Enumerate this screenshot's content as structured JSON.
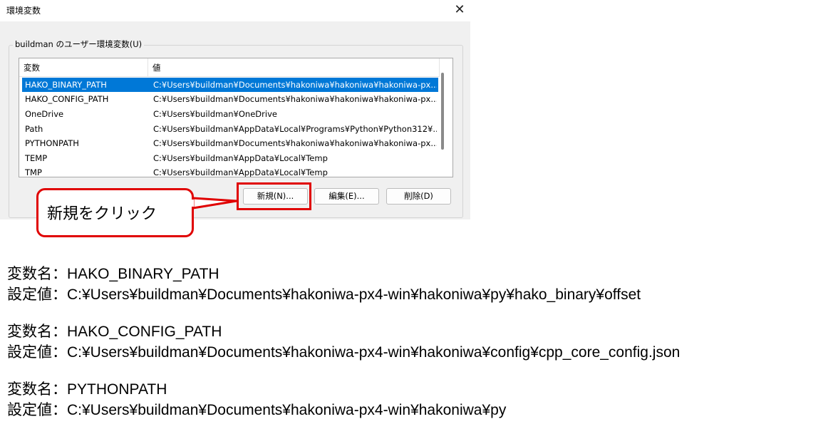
{
  "dialog": {
    "title": "環境変数",
    "close_icon": "close-icon",
    "group_label": "buildman のユーザー環境変数(U)",
    "columns": {
      "name": "変数",
      "value": "値"
    },
    "rows": [
      {
        "name": "HAKO_BINARY_PATH",
        "value": "C:¥Users¥buildman¥Documents¥hakoniwa¥hakoniwa¥hakoniwa-px...",
        "selected": true
      },
      {
        "name": "HAKO_CONFIG_PATH",
        "value": "C:¥Users¥buildman¥Documents¥hakoniwa¥hakoniwa¥hakoniwa-px..."
      },
      {
        "name": "OneDrive",
        "value": "C:¥Users¥buildman¥OneDrive"
      },
      {
        "name": "Path",
        "value": "C:¥Users¥buildman¥AppData¥Local¥Programs¥Python¥Python312¥..."
      },
      {
        "name": "PYTHONPATH",
        "value": "C:¥Users¥buildman¥Documents¥hakoniwa¥hakoniwa¥hakoniwa-px..."
      },
      {
        "name": "TEMP",
        "value": "C:¥Users¥buildman¥AppData¥Local¥Temp"
      },
      {
        "name": "TMP",
        "value": "C:¥Users¥buildman¥AppData¥Local¥Temp"
      }
    ],
    "buttons": {
      "new": "新規(N)...",
      "edit": "編集(E)...",
      "delete": "削除(D)"
    },
    "highlight_color": "#e00000",
    "selection_color": "#0078d7"
  },
  "callout": {
    "text": "新規をクリック"
  },
  "notes": [
    {
      "name_line": "変数名：HAKO_BINARY_PATH",
      "value_line": "設定値：C:¥Users¥buildman¥Documents¥hakoniwa-px4-win¥hakoniwa¥py¥hako_binary¥offset"
    },
    {
      "name_line": "変数名：HAKO_CONFIG_PATH",
      "value_line": "設定値：C:¥Users¥buildman¥Documents¥hakoniwa-px4-win¥hakoniwa¥config¥cpp_core_config.json"
    },
    {
      "name_line": "変数名：PYTHONPATH",
      "value_line": "設定値：C:¥Users¥buildman¥Documents¥hakoniwa-px4-win¥hakoniwa¥py"
    }
  ]
}
